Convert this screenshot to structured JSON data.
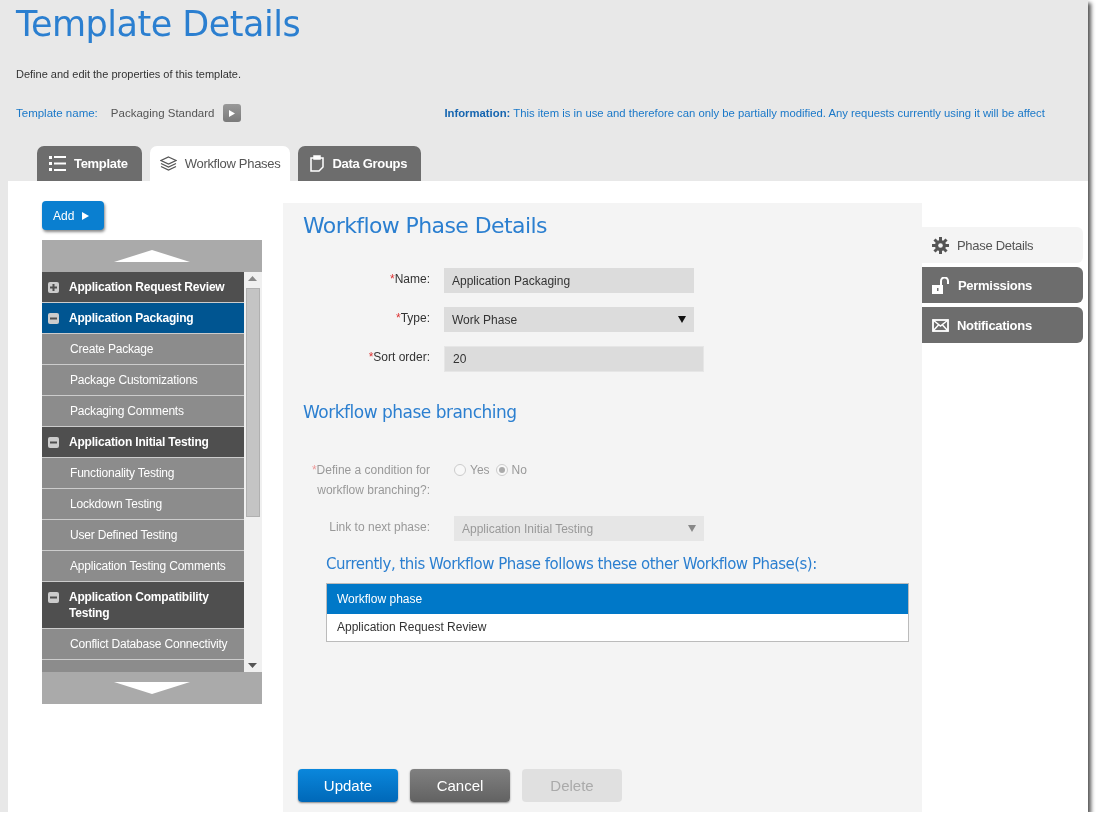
{
  "page": {
    "title": "Template Details",
    "description": "Define and edit the properties of this template.",
    "template_name_label": "Template name:",
    "template_name": "Packaging Standard",
    "info": "**Information:** This item is in use and therefore can only be partially modified. Any requests currently using it will be affect"
  },
  "tabs": [
    {
      "label": "Template",
      "selected": false
    },
    {
      "label": "Workflow Phases",
      "selected": true
    },
    {
      "label": "Data Groups",
      "selected": false
    }
  ],
  "add_button": {
    "label": "Add"
  },
  "phase_tree": [
    {
      "label": "Application Request Review",
      "expanded": false,
      "selected": false
    },
    {
      "label": "Application Packaging",
      "expanded": true,
      "selected": true,
      "children": [
        {
          "label": "Create Package"
        },
        {
          "label": "Package Customizations"
        },
        {
          "label": "Packaging Comments"
        }
      ]
    },
    {
      "label": "Application Initial Testing",
      "expanded": true,
      "selected": false,
      "children": [
        {
          "label": "Functionality Testing"
        },
        {
          "label": "Lockdown Testing"
        },
        {
          "label": "User Defined Testing"
        },
        {
          "label": "Application Testing Comments"
        }
      ]
    },
    {
      "label": "Application Compatibility Testing",
      "expanded": true,
      "selected": false,
      "children": [
        {
          "label": "Conflict Database Connectivity"
        }
      ]
    }
  ],
  "form": {
    "title": "Workflow Phase Details",
    "fields": [
      {
        "kind": "text",
        "marker": "*",
        "label": "Name:",
        "value": "Application Packaging"
      },
      {
        "kind": "select",
        "marker": "*",
        "label": "Type:",
        "value": "Work Phase"
      },
      {
        "kind": "wide",
        "marker": "*",
        "label": "Sort order:",
        "value": "20"
      }
    ]
  },
  "branching": {
    "title": "Workflow phase branching",
    "disabled": true,
    "condition": {
      "marker": "*",
      "label": "Define a condition for workflow branching?:",
      "options": [
        {
          "label": "Yes",
          "selected": false
        },
        {
          "label": "No",
          "selected": true
        }
      ]
    },
    "next_phase": {
      "label": "Link to next phase:",
      "value": "Application Initial Testing"
    }
  },
  "follows": {
    "caption": "Currently, this Workflow Phase follows these other Workflow Phase(s):",
    "column": "Workflow phase",
    "rows": [
      "Application Request Review"
    ]
  },
  "buttons": [
    {
      "label": "Update",
      "kind": "primary",
      "disabled": false
    },
    {
      "label": "Cancel",
      "kind": "secondary",
      "disabled": false
    },
    {
      "label": "Delete",
      "kind": "secondary",
      "disabled": true
    }
  ],
  "side_tabs": [
    {
      "label": "Phase Details",
      "selected": true
    },
    {
      "label": "Permissions",
      "selected": false
    },
    {
      "label": "Notifications",
      "selected": false
    }
  ]
}
